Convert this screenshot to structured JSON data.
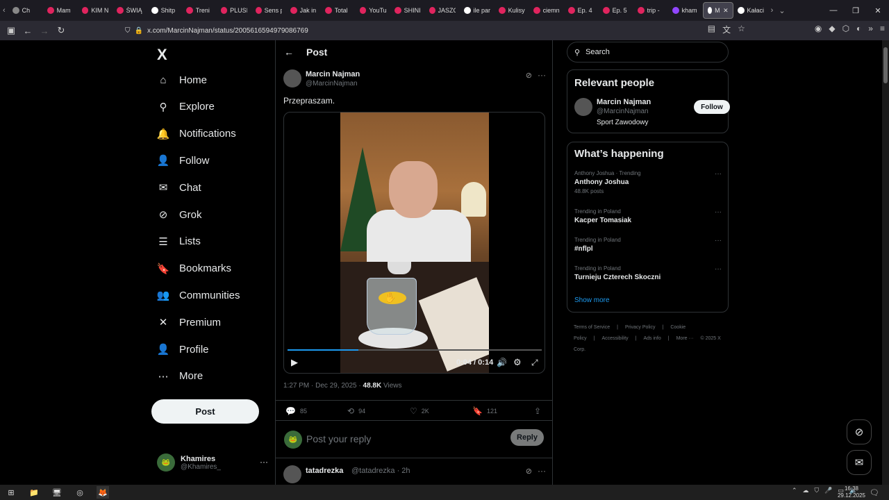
{
  "browser": {
    "tabs": [
      {
        "label": "Ch",
        "color": "#888"
      },
      {
        "label": "Mam",
        "color": "#e0245e"
      },
      {
        "label": "KIM N",
        "color": "#e0245e"
      },
      {
        "label": "ŚWIĄ",
        "color": "#e0245e"
      },
      {
        "label": "Shitp",
        "color": "#fff"
      },
      {
        "label": "Treni",
        "color": "#e0245e"
      },
      {
        "label": "PLUSI",
        "color": "#e0245e"
      },
      {
        "label": "Sens p",
        "color": "#e0245e"
      },
      {
        "label": "Jak in",
        "color": "#e0245e"
      },
      {
        "label": "Total",
        "color": "#e0245e"
      },
      {
        "label": "YouTu",
        "color": "#e0245e"
      },
      {
        "label": "SHINI",
        "color": "#e0245e"
      },
      {
        "label": "JASZC",
        "color": "#e0245e"
      },
      {
        "label": "ile par",
        "color": "#fff"
      },
      {
        "label": "Kulisy",
        "color": "#e0245e"
      },
      {
        "label": "ciemn",
        "color": "#e0245e"
      },
      {
        "label": "Ep. 4",
        "color": "#e0245e"
      },
      {
        "label": "Ep. 5",
        "color": "#e0245e"
      },
      {
        "label": "trip -",
        "color": "#e0245e"
      },
      {
        "label": "kham",
        "color": "#9146ff"
      },
      {
        "label": "Ma",
        "color": "#fff",
        "active": true
      },
      {
        "label": "Kałaci",
        "color": "#fff"
      }
    ],
    "url": "x.com/MarcinNajman/status/2005616594979086769"
  },
  "sidebar": {
    "logo": "X",
    "items": [
      {
        "label": "Home",
        "icon": "home-icon",
        "glyph": "⌂"
      },
      {
        "label": "Explore",
        "icon": "search-icon",
        "glyph": "⚲"
      },
      {
        "label": "Notifications",
        "icon": "bell-icon",
        "glyph": "🔔"
      },
      {
        "label": "Follow",
        "icon": "person-add-icon",
        "glyph": "👤"
      },
      {
        "label": "Chat",
        "icon": "mail-icon",
        "glyph": "✉"
      },
      {
        "label": "Grok",
        "icon": "grok-icon",
        "glyph": "⊘"
      },
      {
        "label": "Lists",
        "icon": "list-icon",
        "glyph": "☰"
      },
      {
        "label": "Bookmarks",
        "icon": "bookmark-icon",
        "glyph": "🔖"
      },
      {
        "label": "Communities",
        "icon": "communities-icon",
        "glyph": "👥"
      },
      {
        "label": "Premium",
        "icon": "x-icon",
        "glyph": "✕"
      },
      {
        "label": "Profile",
        "icon": "profile-icon",
        "glyph": "👤"
      },
      {
        "label": "More",
        "icon": "more-circle-icon",
        "glyph": "⋯"
      }
    ],
    "post_label": "Post",
    "account": {
      "name": "Khamires",
      "handle": "@Khamires_"
    }
  },
  "main": {
    "header_title": "Post",
    "author": {
      "name": "Marcin Najman",
      "handle": "@MarcinNajman"
    },
    "text": "Przepraszam.",
    "video": {
      "time": "0:04 / 0:14",
      "progress": 0.28
    },
    "meta": {
      "time": "1:27 PM · Dec 29, 2025 · ",
      "views": "48.8K",
      "views_label": " Views"
    },
    "actions": {
      "replies": "85",
      "reposts": "94",
      "likes": "2K",
      "bookmarks": "121"
    },
    "reply_placeholder": "Post your reply",
    "reply_button": "Reply",
    "first_reply": {
      "name": "tatadrezka",
      "handle": "@tatadrezka · 2h"
    }
  },
  "right": {
    "search_placeholder": "Search",
    "relevant_title": "Relevant people",
    "relevant": {
      "name": "Marcin Najman",
      "handle": "@MarcinNajman",
      "bio": "Sport Zawodowy",
      "follow": "Follow"
    },
    "happening_title": "What’s happening",
    "trends": [
      {
        "context": "Anthony Joshua · Trending",
        "title": "Anthony Joshua",
        "posts": "48.8K posts"
      },
      {
        "context": "Trending in Poland",
        "title": "Kacper Tomasiak",
        "posts": ""
      },
      {
        "context": "Trending in Poland",
        "title": "#nflpl",
        "posts": ""
      },
      {
        "context": "Trending in Poland",
        "title": "Turnieju Czterech Skoczni",
        "posts": ""
      }
    ],
    "show_more": "Show more",
    "footer": [
      "Terms of Service",
      "|",
      "Privacy Policy",
      "|",
      "Cookie Policy",
      "|",
      "Accessibility",
      "|",
      "Ads info",
      "|",
      "More ···",
      "© 2025 X Corp."
    ]
  },
  "taskbar": {
    "time": "16:38",
    "date": "29.12.2025"
  }
}
